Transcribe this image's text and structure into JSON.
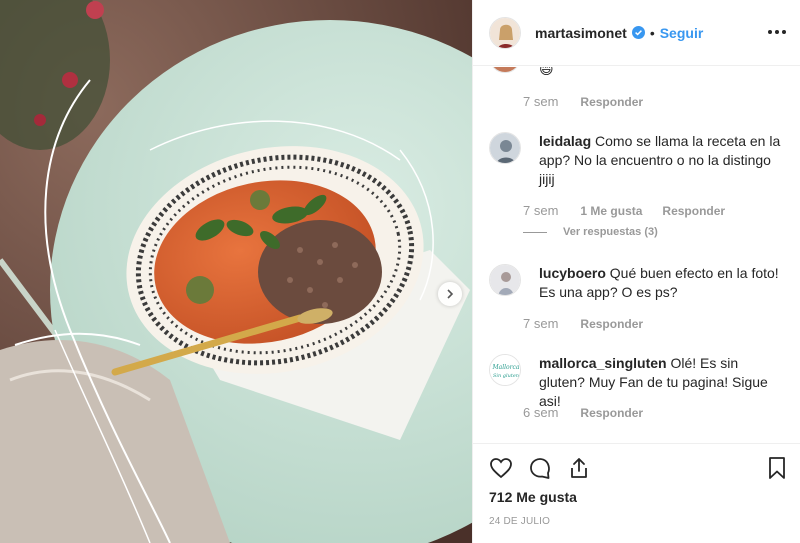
{
  "post": {
    "username": "martasimonet",
    "separator": "•",
    "follow_label": "Seguir",
    "verified": true
  },
  "partial_comment": {
    "emoji": "😄",
    "time": "7 sem",
    "reply_label": "Responder"
  },
  "comments": [
    {
      "username": "leidalag",
      "text": "Como se llama la receta en la app? No la encuentro o no la distingo jijij",
      "time": "7 sem",
      "likes": "1 Me gusta",
      "reply_label": "Responder",
      "view_replies": "Ver respuestas (3)"
    },
    {
      "username": "lucyboero",
      "text": "Qué buen efecto en la foto! Es una app? O es ps?",
      "time": "7 sem",
      "reply_label": "Responder"
    },
    {
      "username": "mallorca_singluten",
      "text": "Olé! Es sin gluten? Muy Fan de tu pagina! Sigue asi!",
      "time": "6 sem",
      "reply_label": "Responder",
      "avatar_text": "Mallorca Sin gluten"
    }
  ],
  "footer": {
    "likes": "712 Me gusta",
    "date": "24 de julio"
  },
  "colors": {
    "link": "#3897f0",
    "text": "#262626",
    "muted": "#999999",
    "verified": "#3897f0"
  },
  "icons": [
    "heart-icon",
    "comment-icon",
    "share-icon",
    "bookmark-icon",
    "more-icon",
    "verified-icon",
    "chevron-right-icon"
  ]
}
